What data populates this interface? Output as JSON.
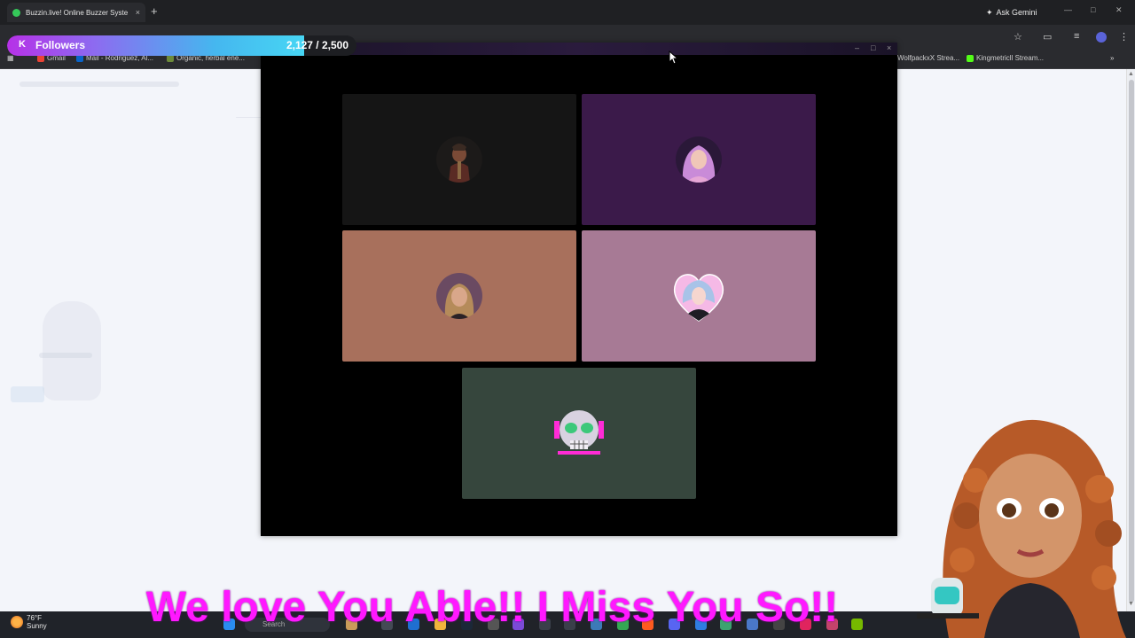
{
  "browser": {
    "tab_title": "Buzzin.live! Online Buzzer Syste",
    "tab_close": "×",
    "new_tab": "+",
    "ask_gemini": "Ask Gemini",
    "bookmarks": [
      {
        "label": "Gmail",
        "color": "#ea4335"
      },
      {
        "label": "Mail - Rodriguez, Al...",
        "color": "#0a64c9"
      },
      {
        "label": "Organic, herbal ene...",
        "color": "#6d8a3a"
      },
      {
        "label": "WolfpackxX Strea...",
        "color": "#888888"
      },
      {
        "label": "Kingmetricll Stream...",
        "color": "#53fc18"
      }
    ]
  },
  "followers_goal": {
    "label": "Followers",
    "count": "2,127 / 2,500",
    "progress": 0.8508,
    "brand_icon": "kick-icon"
  },
  "meeting": {
    "window_controls": [
      "–",
      "□",
      "×"
    ],
    "tiles": [
      {
        "name": "participant-1",
        "bg": "#151515",
        "avatar": "armored-warrior"
      },
      {
        "name": "participant-2",
        "bg": "#3b1a4a",
        "avatar": "pink-hair-woman"
      },
      {
        "name": "participant-3",
        "bg": "#a8705c",
        "avatar": "woman-portrait"
      },
      {
        "name": "participant-4",
        "bg": "#a77a95",
        "avatar": "heart-portrait"
      },
      {
        "name": "participant-5",
        "bg": "#36463d",
        "avatar": "neon-skull"
      }
    ]
  },
  "caption": {
    "text": "We love You Able!! I Miss You So!!",
    "color": "#ff18ff"
  },
  "taskbar": {
    "temperature": "76°F",
    "condition": "Sunny",
    "search_placeholder": "Search"
  }
}
